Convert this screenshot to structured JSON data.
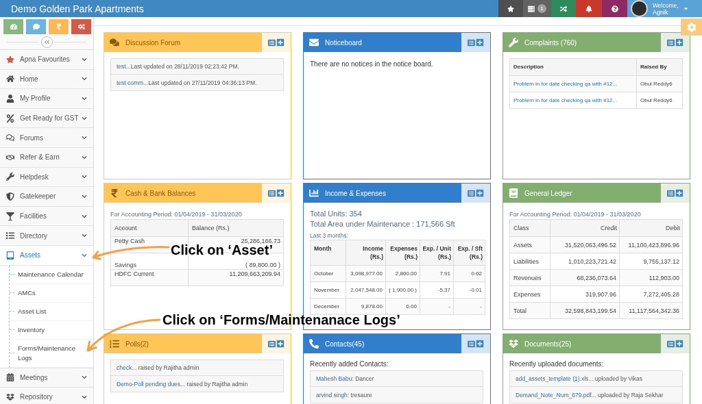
{
  "header": {
    "title": "Demo Golden Park Apartments",
    "badge": "1",
    "greeting": "Welcome,",
    "user": "Agnik"
  },
  "sidebar": {
    "items": [
      {
        "label": "Apna Favourites",
        "expanded": false
      },
      {
        "label": "Home",
        "expanded": false
      },
      {
        "label": "My Profile",
        "expanded": false
      },
      {
        "label": "Get Ready for GST",
        "expanded": false
      },
      {
        "label": "Forums",
        "expanded": false
      },
      {
        "label": "Refer & Earn",
        "expanded": false
      },
      {
        "label": "Helpdesk",
        "expanded": false
      },
      {
        "label": "Gatekeeper",
        "expanded": false
      },
      {
        "label": "Facilities",
        "expanded": false
      },
      {
        "label": "Directory",
        "expanded": false
      },
      {
        "label": "Assets",
        "expanded": true,
        "children": [
          {
            "label": "Maintenance Calendar"
          },
          {
            "label": "AMCs"
          },
          {
            "label": "Asset List"
          },
          {
            "label": "Inventory"
          },
          {
            "label": "Forms/Maintenance Logs"
          }
        ]
      },
      {
        "label": "Meetings",
        "expanded": false
      },
      {
        "label": "Repository",
        "expanded": false
      }
    ]
  },
  "widgets": [
    {
      "title": "Discussion Forum",
      "color": "#ffc657",
      "kind": "links",
      "items": [
        {
          "link": "test...",
          "text": "Last updated on 28/11/2019 02:23:42 PM."
        },
        {
          "link": "test comm...",
          "text": "Last updated on 27/11/2019 04:36:13 PM."
        }
      ]
    },
    {
      "title": "Noticeboard",
      "color": "#307ecc",
      "kind": "notice",
      "message": "There are no notices in the notice board."
    },
    {
      "title": "Complaints (760)",
      "color": "#82af6f",
      "kind": "text_table",
      "table": {
        "columns": [
          "Description",
          "Raised By"
        ],
        "rows": [
          [
            "Problem in for date checking qa with #12...",
            "Obul Reddy6"
          ],
          [
            "Problem in for date checking qa with #12...",
            "Obul Reddy6"
          ]
        ]
      }
    },
    {
      "title": "Cash & Bank Balances",
      "color": "#ffc657",
      "kind": "amount_table",
      "period": "For Accounting Period: 01/04/2019 - 31/03/2020",
      "table": {
        "columns": [
          "Account",
          "Balance (Rs.)"
        ],
        "rows": [
          [
            "Petty Cash",
            "25,286,166.73"
          ],
          [
            "Savings",
            "( 89,800.00 )"
          ],
          [
            "HDFC Current",
            "11,209,663,209.94"
          ]
        ]
      }
    },
    {
      "title": "Income & Expenses",
      "color": "#307ecc",
      "kind": "stats",
      "summary": [
        "Total Units: 354",
        "Total Area under Maintenance : 171,566 Sft"
      ],
      "note": "Last 3 months:",
      "table": {
        "columns": [
          "Month",
          "Income (Rs.)",
          "Expenses (Rs.)",
          "Exp. / Unit (Rs.)",
          "Exp. / Sft (Rs.)"
        ],
        "rows": [
          [
            "October",
            "3,098,977.00",
            "2,800.00",
            "7.91",
            "0.02"
          ],
          [
            "November",
            "2,047,548.00",
            "( 1,900.00 )",
            "-5.37",
            "-0.01"
          ],
          [
            "December",
            "9,878.00",
            "0.00",
            "-",
            "-"
          ]
        ]
      }
    },
    {
      "title": "General Ledger",
      "color": "#82af6f",
      "kind": "amount_table",
      "period": "For Accounting Period: 01/04/2019 - 31/03/2020",
      "table": {
        "columns": [
          "Class",
          "Credit",
          "Debit"
        ],
        "rows": [
          [
            "Assets",
            "31,520,063,496.52",
            "11,100,423,896.96"
          ],
          [
            "Liabilities",
            "1,010,223,721.42",
            "9,755,137.12"
          ],
          [
            "Revenues",
            "68,236,073.64",
            "112,903.00"
          ],
          [
            "Expenses",
            "319,907.96",
            "7,272,405.28"
          ],
          [
            "Total",
            "32,598,843,199.54",
            "11,117,564,342.36"
          ]
        ]
      }
    },
    {
      "title": "Polls(2)",
      "color": "#ffc657",
      "kind": "links",
      "items": [
        {
          "link": "check...",
          "text": " raised by Rajitha admin"
        },
        {
          "link": "Demo-Poll pending dues...",
          "text": " raised by Rajitha admin"
        }
      ]
    },
    {
      "title": "Contacts(45)",
      "color": "#307ecc",
      "kind": "links",
      "intro": "Recently added Contacts:",
      "items": [
        {
          "link": "Mahesh Babu",
          "text": ": Dancer"
        },
        {
          "link": "arvind singh",
          "text": ": tresaure"
        }
      ]
    },
    {
      "title": "Documents(25)",
      "color": "#82af6f",
      "kind": "links",
      "intro": "Recently uploaded documents:",
      "items": [
        {
          "link": "add_assets_template (1).xls...",
          "text": " uploaded by Vikas"
        },
        {
          "link": "Demand_Note_Num_679.pdf...",
          "text": " uploaded by Raja Sekhar"
        }
      ]
    }
  ],
  "annotations": [
    {
      "text": "Click on ‘Asset’"
    },
    {
      "text": "Click on ‘Forms/Maintenanace Logs’"
    }
  ]
}
